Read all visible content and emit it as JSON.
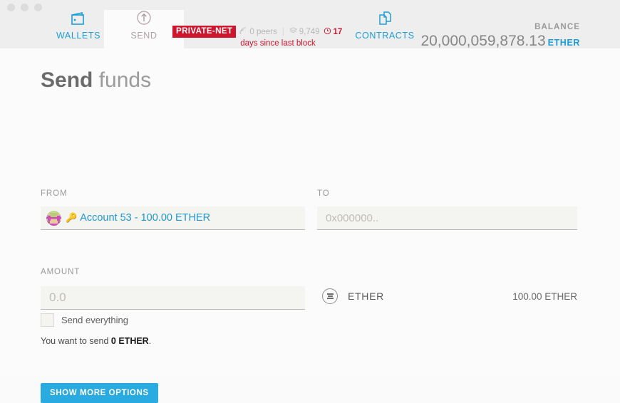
{
  "window": {
    "dots": [
      "close-dot",
      "minimize-dot",
      "maximize-dot"
    ]
  },
  "header": {
    "tabs": [
      {
        "id": "wallets",
        "label": "WALLETS",
        "icon": "wallet-icon",
        "active": false
      },
      {
        "id": "send",
        "label": "SEND",
        "icon": "send-arrow-up-icon",
        "active": true
      },
      {
        "id": "contracts",
        "label": "CONTRACTS",
        "icon": "contracts-documents-icon",
        "active": false
      }
    ],
    "status": {
      "network_badge": "PRIVATE-NET",
      "peers": "0 peers",
      "peers_icon": "signal-icon",
      "separator": "|",
      "blocks": "9,749",
      "blocks_icon": "blocks-stack-icon",
      "last_block_value": "17",
      "last_block_icon": "clock-icon",
      "last_block_text": "days since last block"
    },
    "balance": {
      "label": "BALANCE",
      "value": "20,000,059,878.13",
      "unit": "ETHER"
    }
  },
  "main": {
    "title_strong": "Send",
    "title_light": " funds",
    "from": {
      "label": "FROM",
      "account_icon": "identicon",
      "key_icon": "key-icon",
      "value": "Account 53 - 100.00 ETHER"
    },
    "to": {
      "label": "TO",
      "value": "",
      "placeholder": "0x000000.."
    },
    "amount": {
      "label": "AMOUNT",
      "value": "",
      "placeholder": "0.0"
    },
    "send_everything": {
      "label": "Send everything",
      "checked": false
    },
    "send_note_prefix": "You want to send ",
    "send_note_value": "0 ETHER",
    "send_note_suffix": ".",
    "currency": {
      "icon": "ether-symbol-icon",
      "name": "ETHER",
      "available": "100.00 ETHER"
    },
    "show_more_options": "SHOW MORE OPTIONS"
  },
  "colors": {
    "accent_blue": "#1b9dd9",
    "button_blue": "#29abe2",
    "alert_red": "#cf152d",
    "header_bg": "#eeeeee",
    "content_bg": "#fbfbfb",
    "input_bg": "#f4f4f0"
  }
}
